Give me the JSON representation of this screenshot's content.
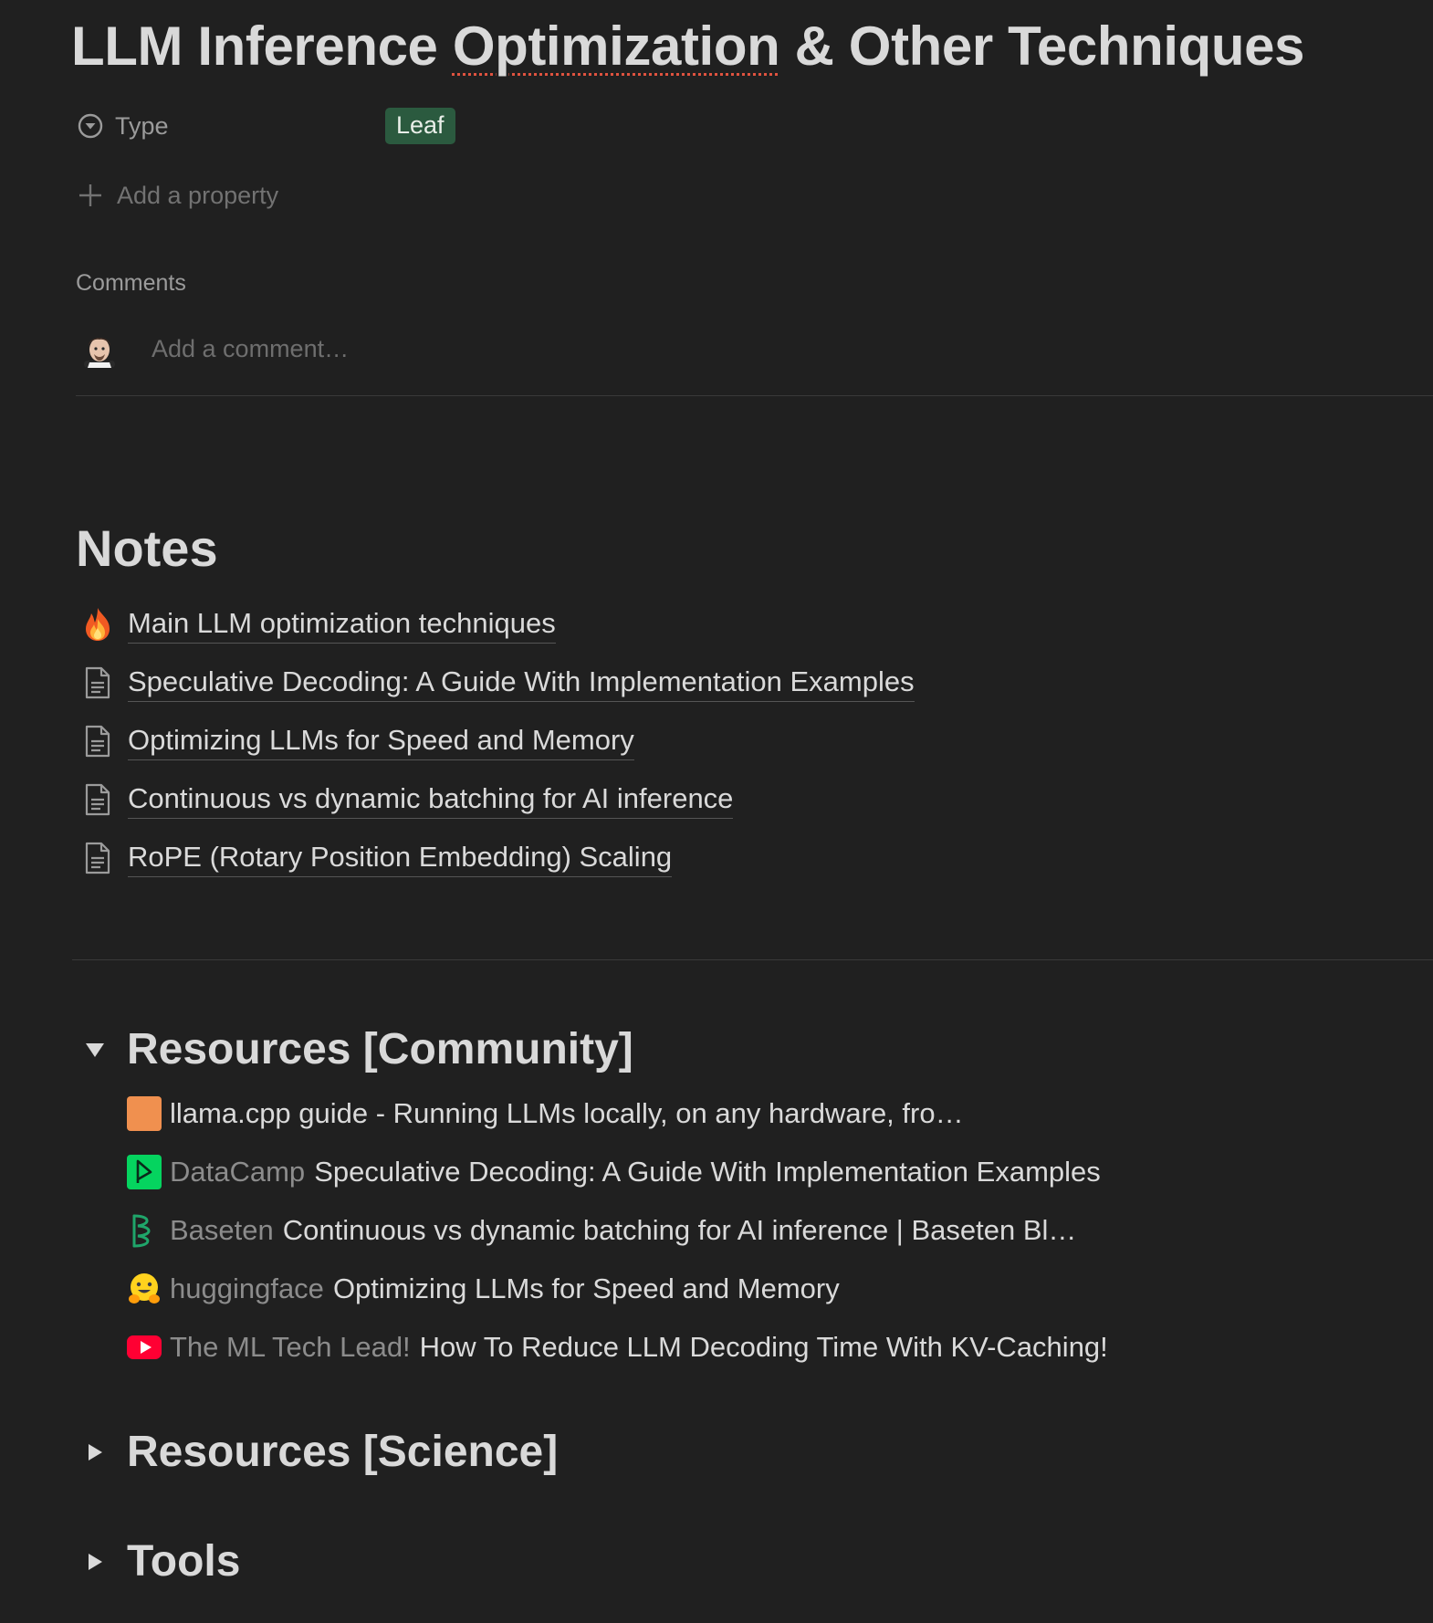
{
  "page": {
    "title_before": "LLM Inference ",
    "title_spell": "Optimization",
    "title_after": " & Other Techniques"
  },
  "properties": {
    "type_label": "Type",
    "type_value": "Leaf",
    "add_property": "Add a property"
  },
  "comments": {
    "label": "Comments",
    "placeholder": "Add a comment…"
  },
  "notes": {
    "heading": "Notes",
    "items": [
      {
        "icon": "fire-icon",
        "label": "Main LLM optimization techniques"
      },
      {
        "icon": "page-icon",
        "label": "Speculative Decoding: A Guide With Implementation Examples"
      },
      {
        "icon": "page-icon",
        "label": "Optimizing LLMs for Speed and Memory"
      },
      {
        "icon": "page-icon",
        "label": "Continuous vs dynamic batching for AI inference"
      },
      {
        "icon": "page-icon",
        "label": "RoPE (Rotary Position Embedding) Scaling"
      }
    ]
  },
  "resources_community": {
    "heading": "Resources [Community]",
    "expanded": true,
    "items": [
      {
        "icon": "orange-square-icon",
        "source": "",
        "title": "llama.cpp guide - Running LLMs locally, on any hardware, fro…"
      },
      {
        "icon": "datacamp-icon",
        "source": "DataCamp",
        "title": "Speculative Decoding: A Guide With Implementation Examples"
      },
      {
        "icon": "baseten-icon",
        "source": "Baseten",
        "title": "Continuous vs dynamic batching for AI inference | Baseten Bl…"
      },
      {
        "icon": "hugging-face-icon",
        "source": "huggingface",
        "title": "Optimizing LLMs for Speed and Memory"
      },
      {
        "icon": "youtube-icon",
        "source": "The ML Tech Lead!",
        "title": "How To Reduce LLM Decoding Time With KV-Caching!"
      }
    ]
  },
  "resources_science": {
    "heading": "Resources [Science]",
    "expanded": false
  },
  "tools": {
    "heading": "Tools",
    "expanded": false
  },
  "colors": {
    "background": "#202020",
    "tag_green": "#2b5a3f",
    "datacamp_green": "#05d45f",
    "youtube_red": "#ff0033",
    "orange": "#f0904f"
  }
}
